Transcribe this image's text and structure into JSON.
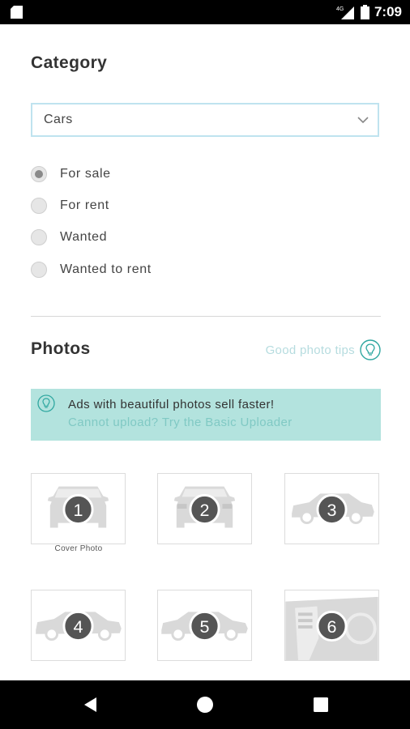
{
  "status_bar": {
    "time": "7:09",
    "network": "4G"
  },
  "category": {
    "title": "Category",
    "selected": "Cars",
    "options": [
      "For sale",
      "For rent",
      "Wanted",
      "Wanted to rent"
    ],
    "checked_option": "For sale"
  },
  "photos": {
    "title": "Photos",
    "tips_label": "Good photo tips",
    "banner_message": "Ads with beautiful photos sell faster!",
    "banner_link": "Cannot upload? Try the Basic Uploader",
    "cover_caption": "Cover Photo",
    "slots": [
      {
        "number": "1",
        "icon": "car-front-icon"
      },
      {
        "number": "2",
        "icon": "car-rear-icon"
      },
      {
        "number": "3",
        "icon": "car-side-icon"
      },
      {
        "number": "4",
        "icon": "car-side-icon"
      },
      {
        "number": "5",
        "icon": "car-side-icon"
      },
      {
        "number": "6",
        "icon": "car-interior-icon"
      }
    ]
  },
  "nav": {
    "back": "back-icon",
    "home": "home-icon",
    "recents": "recents-icon"
  },
  "colors": {
    "accent": "#2fa7a0",
    "banner": "#b3e3de",
    "select_border": "#bfe3ef"
  }
}
